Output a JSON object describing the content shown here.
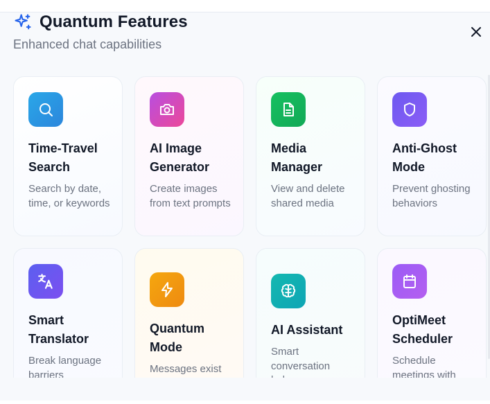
{
  "header": {
    "title": "Quantum Features",
    "subtitle": "Enhanced chat capabilities"
  },
  "features": [
    {
      "title": "Time-Travel Search",
      "description": "Search by date, time, or keywords",
      "icon": "search-icon",
      "color": "#2f9be0"
    },
    {
      "title": "AI Image Generator",
      "description": "Create images from text prompts",
      "icon": "camera-icon",
      "color": "#d946a8"
    },
    {
      "title": "Media Manager",
      "description": "View and delete shared media",
      "icon": "file-text-icon",
      "color": "#16b35a"
    },
    {
      "title": "Anti-Ghost Mode",
      "description": "Prevent ghosting behaviors",
      "icon": "shield-icon",
      "color": "#7c5cf0"
    },
    {
      "title": "Smart Translator",
      "description": "Break language barriers",
      "icon": "translate-icon",
      "color": "#6f58f0"
    },
    {
      "title": "Quantum Mode",
      "description": "Messages exist until observed",
      "icon": "lightning-icon",
      "color": "#f29a0d"
    },
    {
      "title": "AI Assistant",
      "description": "Smart conversation helper",
      "icon": "brain-icon",
      "color": "#14b3b0"
    },
    {
      "title": "OptiMeet Scheduler",
      "description": "Schedule meetings with",
      "icon": "calendar-icon",
      "color": "#a855f7"
    }
  ]
}
